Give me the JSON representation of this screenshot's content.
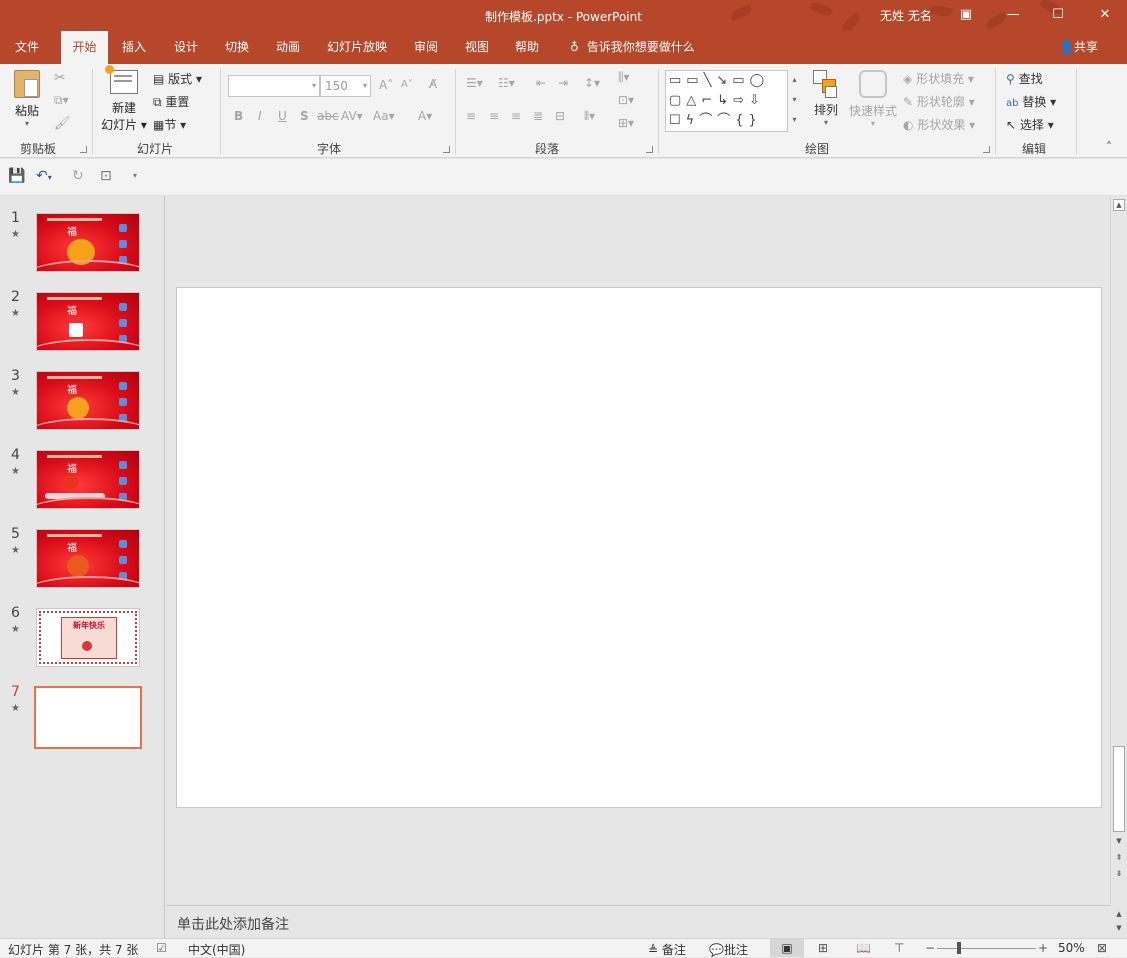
{
  "window": {
    "title": "制作模板.pptx  -  PowerPoint",
    "user": "无姓 无名"
  },
  "tabs": [
    {
      "label": "文件",
      "active": false
    },
    {
      "label": "开始",
      "active": true
    },
    {
      "label": "插入",
      "active": false
    },
    {
      "label": "设计",
      "active": false
    },
    {
      "label": "切换",
      "active": false
    },
    {
      "label": "动画",
      "active": false
    },
    {
      "label": "幻灯片放映",
      "active": false
    },
    {
      "label": "审阅",
      "active": false
    },
    {
      "label": "视图",
      "active": false
    },
    {
      "label": "帮助",
      "active": false
    }
  ],
  "tell_me": "告诉我你想要做什么",
  "share": "共享",
  "ribbon": {
    "clipboard": {
      "paste": "粘贴",
      "group": "剪贴板"
    },
    "slides": {
      "new_slide_1": "新建",
      "new_slide_2": "幻灯片",
      "layout": "版式",
      "reset": "重置",
      "section": "节",
      "group": "幻灯片"
    },
    "font": {
      "font_name": "",
      "font_size": "150",
      "group": "字体"
    },
    "paragraph": {
      "group": "段落"
    },
    "drawing": {
      "arrange": "排列",
      "quick_styles": "快速样式",
      "shape_fill": "形状填充",
      "shape_outline": "形状轮廓",
      "shape_effects": "形状效果",
      "group": "绘图"
    },
    "editing": {
      "find": "查找",
      "replace": "替换",
      "select": "选择",
      "group": "编辑"
    }
  },
  "slides": [
    {
      "number": "1",
      "kind": "red"
    },
    {
      "number": "2",
      "kind": "red"
    },
    {
      "number": "3",
      "kind": "red"
    },
    {
      "number": "4",
      "kind": "red"
    },
    {
      "number": "5",
      "kind": "red"
    },
    {
      "number": "6",
      "kind": "card",
      "card_title": "新年快乐"
    },
    {
      "number": "7",
      "kind": "blank",
      "selected": true
    }
  ],
  "notes_placeholder": "单击此处添加备注",
  "status": {
    "slide_info": "幻灯片 第 7 张，共 7 张",
    "language": "中文(中国)",
    "notes_btn": "备注",
    "comments_btn": "批注",
    "zoom": "50%"
  },
  "colors": {
    "accent": "#b7472a",
    "selected_thumb": "#e8714b"
  }
}
